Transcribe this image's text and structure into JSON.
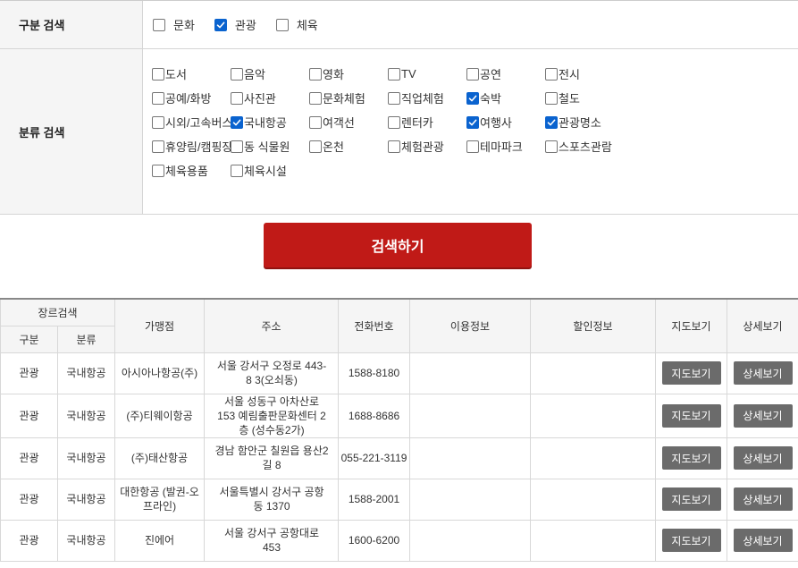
{
  "filter": {
    "gubun_label": "구분 검색",
    "gubun_options": [
      {
        "label": "문화",
        "checked": false
      },
      {
        "label": "관광",
        "checked": true
      },
      {
        "label": "체육",
        "checked": false
      }
    ],
    "bunryu_label": "분류 검색",
    "bunryu_options": [
      {
        "label": "도서",
        "checked": false
      },
      {
        "label": "음악",
        "checked": false
      },
      {
        "label": "영화",
        "checked": false
      },
      {
        "label": "TV",
        "checked": false
      },
      {
        "label": "공연",
        "checked": false
      },
      {
        "label": "전시",
        "checked": false
      },
      {
        "label": "공예/화방",
        "checked": false
      },
      {
        "label": "사진관",
        "checked": false
      },
      {
        "label": "문화체험",
        "checked": false
      },
      {
        "label": "직업체험",
        "checked": false
      },
      {
        "label": "숙박",
        "checked": true
      },
      {
        "label": "철도",
        "checked": false
      },
      {
        "label": "시외/고속버스",
        "checked": false
      },
      {
        "label": "국내항공",
        "checked": true
      },
      {
        "label": "여객선",
        "checked": false
      },
      {
        "label": "렌터카",
        "checked": false
      },
      {
        "label": "여행사",
        "checked": true
      },
      {
        "label": "관광명소",
        "checked": true
      },
      {
        "label": "휴양림/캠핑장",
        "checked": false
      },
      {
        "label": "동 식물원",
        "checked": false
      },
      {
        "label": "온천",
        "checked": false
      },
      {
        "label": "체험관광",
        "checked": false
      },
      {
        "label": "테마파크",
        "checked": false
      },
      {
        "label": "스포츠관람",
        "checked": false
      },
      {
        "label": "체육용품",
        "checked": false
      },
      {
        "label": "체육시설",
        "checked": false
      }
    ]
  },
  "search_button_label": "검색하기",
  "table": {
    "group_header": "장르검색",
    "col_gubun": "구분",
    "col_bunryu": "분류",
    "col_name": "가맹점",
    "col_addr": "주소",
    "col_phone": "전화번호",
    "col_usage": "이용정보",
    "col_discount": "할인정보",
    "col_map": "지도보기",
    "col_detail": "상세보기",
    "map_btn": "지도보기",
    "detail_btn": "상세보기",
    "rows": [
      {
        "gubun": "관광",
        "bunryu": "국내항공",
        "name": "아시아나항공(주)",
        "addr": "서울 강서구 오정로 443-8 3(오쇠동)",
        "phone": "1588-8180",
        "usage": "",
        "discount": ""
      },
      {
        "gubun": "관광",
        "bunryu": "국내항공",
        "name": "(주)티웨이항공",
        "addr": "서울 성동구 아차산로 153 예림출판문화센터 2층 (성수동2가)",
        "phone": "1688-8686",
        "usage": "",
        "discount": ""
      },
      {
        "gubun": "관광",
        "bunryu": "국내항공",
        "name": "(주)태산항공",
        "addr": "경남 함안군 칠원읍 용산2길 8",
        "phone": "055-221-3119",
        "usage": "",
        "discount": ""
      },
      {
        "gubun": "관광",
        "bunryu": "국내항공",
        "name": "대한항공 (발권-오프라인)",
        "addr": "서울특별시 강서구 공항동 1370",
        "phone": "1588-2001",
        "usage": "",
        "discount": ""
      },
      {
        "gubun": "관광",
        "bunryu": "국내항공",
        "name": "진에어",
        "addr": "서울 강서구 공항대로 453",
        "phone": "1600-6200",
        "usage": "",
        "discount": ""
      }
    ]
  }
}
